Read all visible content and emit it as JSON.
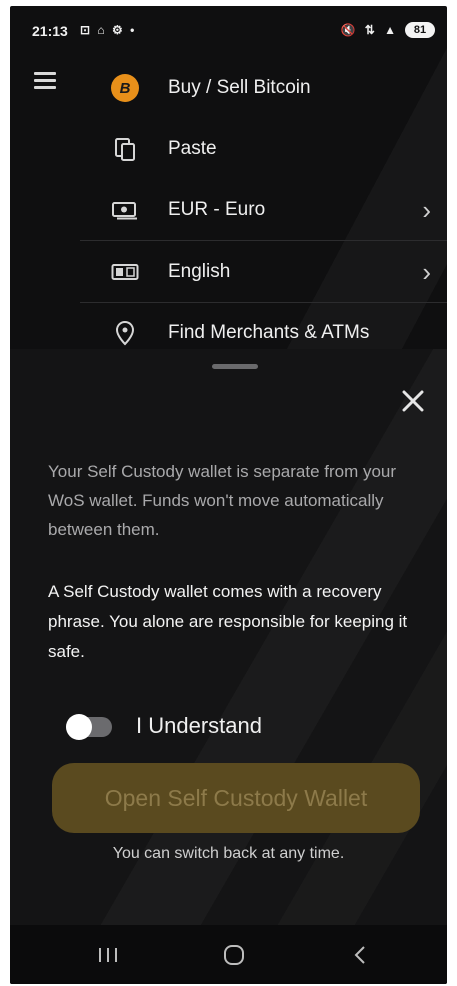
{
  "status_bar": {
    "time": "21:13",
    "left_icons": "⊡ ⌂ ⚙ •",
    "right_icons": "🔇 ⇅ ▲",
    "battery": "81"
  },
  "menu": {
    "items": [
      {
        "label": "Buy / Sell Bitcoin",
        "icon": "bitcoin-icon",
        "icon_glyph": "B"
      },
      {
        "label": "Paste",
        "icon": "clipboard-icon"
      },
      {
        "label": "EUR - Euro",
        "icon": "banknote-icon",
        "chevron": "›"
      },
      {
        "label": "English",
        "icon": "language-icon",
        "chevron": "›"
      },
      {
        "label": "Find Merchants & ATMs",
        "icon": "location-pin-icon"
      }
    ]
  },
  "sheet": {
    "close_glyph": "✕",
    "paragraph1": "Your Self Custody wallet is separate from your WoS wallet. Funds won't move automatically between them.",
    "paragraph2": "A Self Custody wallet comes with a recovery phrase. You alone are responsible for keeping it safe.",
    "toggle_label": "I Understand",
    "toggle_on": false,
    "open_button_label": "Open Self Custody Wallet",
    "note": "You can switch back at any time."
  },
  "colors": {
    "background": "#0f0f10",
    "sheet": "#141415",
    "bitcoin_orange": "#e8901a",
    "button_disabled_bg": "#5a4a1f",
    "button_disabled_text": "#8d7a4a"
  }
}
